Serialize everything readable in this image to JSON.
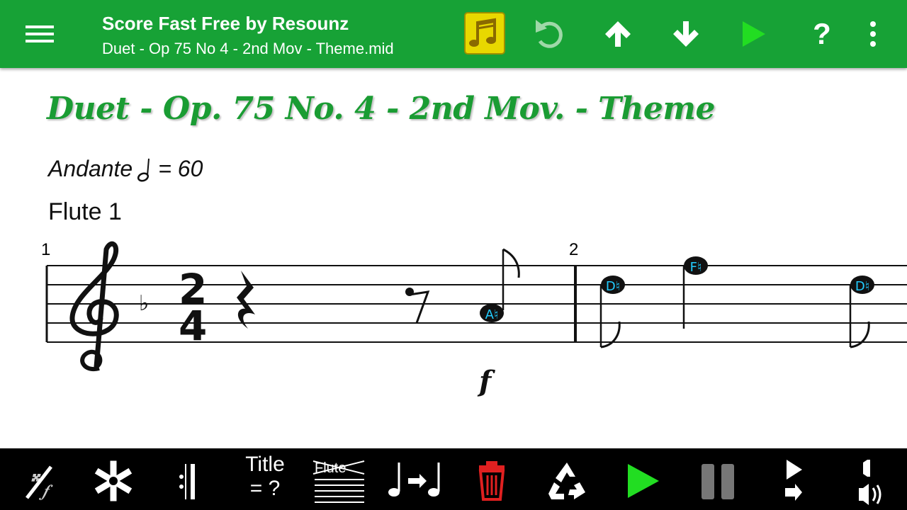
{
  "app": {
    "title": "Score Fast Free by Resounz",
    "file_name": "Duet - Op 75 No 4 - 2nd Mov - Theme.mid"
  },
  "toolbar": {
    "icons": [
      "menu-icon",
      "music-library-icon",
      "undo-icon",
      "arrow-up-icon",
      "arrow-down-icon",
      "play-icon",
      "help-icon",
      "more-vert-icon"
    ],
    "colors": {
      "bar": "#17a236",
      "play": "#22dd22",
      "library": "#e8d800"
    }
  },
  "score": {
    "title": "Duet - Op. 75 No. 4 - 2nd Mov. - Theme",
    "tempo_word": "Andante",
    "tempo_value": "= 60",
    "instrument": "Flute 1",
    "time_signature": {
      "top": "2",
      "bottom": "4"
    },
    "key_signature": "♭",
    "measures": [
      {
        "number": "1",
        "notes": [
          {
            "label": "A♮"
          }
        ],
        "dynamic": "f"
      },
      {
        "number": "2",
        "notes": [
          {
            "label": "D♮"
          },
          {
            "label": "F♮"
          },
          {
            "label": "D♮"
          }
        ]
      }
    ]
  },
  "bottom": {
    "title_button_line1": "Title",
    "title_button_line2": "= ?",
    "stave_label": "Flute",
    "icons": [
      "ornament-icon",
      "asterisk-icon",
      "barline-icon",
      "stave-edit-icon",
      "note-replace-icon",
      "delete-icon",
      "recycle-icon",
      "play-icon",
      "pause-icon",
      "step-forward-icon",
      "volume-icon"
    ],
    "colors": {
      "delete": "#e02020",
      "play": "#22dd22",
      "pause": "#777777"
    }
  }
}
